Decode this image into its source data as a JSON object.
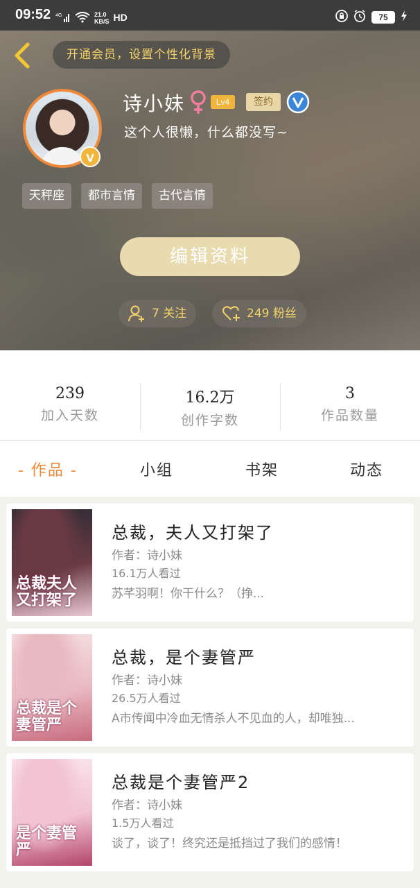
{
  "status_bar": {
    "time": "09:52",
    "network": "4G",
    "speed_value": "21.0",
    "speed_unit": "KB/S",
    "hd": "HD",
    "battery": "75"
  },
  "header": {
    "vip_banner": "开通会员，设置个性化背景",
    "username": "诗小妹",
    "level": "Lv4",
    "signed_label": "签约",
    "bio": "这个人很懒，什么都没写~",
    "tags": [
      "天秤座",
      "都市言情",
      "古代言情"
    ],
    "edit_button": "编辑资料",
    "follow_label": "7 关注",
    "fans_label": "249 粉丝"
  },
  "stats": [
    {
      "value": "239",
      "label": "加入天数"
    },
    {
      "value": "16.2万",
      "label": "创作字数"
    },
    {
      "value": "3",
      "label": "作品数量"
    }
  ],
  "tabs": [
    {
      "label": "- 作品 -",
      "active": true
    },
    {
      "label": "小组",
      "active": false
    },
    {
      "label": "书架",
      "active": false
    },
    {
      "label": "动态",
      "active": false
    }
  ],
  "works": [
    {
      "title": "总裁，夫人又打架了",
      "author": "作者：诗小妹",
      "views": "16.1万人看过",
      "desc": "苏芊羽啊！你干什么？（挣...",
      "cover_text": "总裁夫人又打架了",
      "cover_colors": [
        "#2a2a33",
        "#6a3a44",
        "#e7c7d3"
      ]
    },
    {
      "title": "总裁，是个妻管严",
      "author": "作者：诗小妹",
      "views": "26.5万人看过",
      "desc": "A市传闻中冷血无情杀人不见血的人，却唯独...",
      "cover_text": "总裁是个妻管严",
      "cover_colors": [
        "#f7e4e6",
        "#e9b9c1",
        "#c86b7e"
      ]
    },
    {
      "title": "总裁是个妻管严2",
      "author": "作者：诗小妹",
      "views": "1.5万人看过",
      "desc": "谈了，谈了！终究还是抵挡过了我们的感情！",
      "cover_text": "是个妻管严",
      "cover_colors": [
        "#fbe9ef",
        "#f2c3d2",
        "#b3466b"
      ]
    }
  ]
}
